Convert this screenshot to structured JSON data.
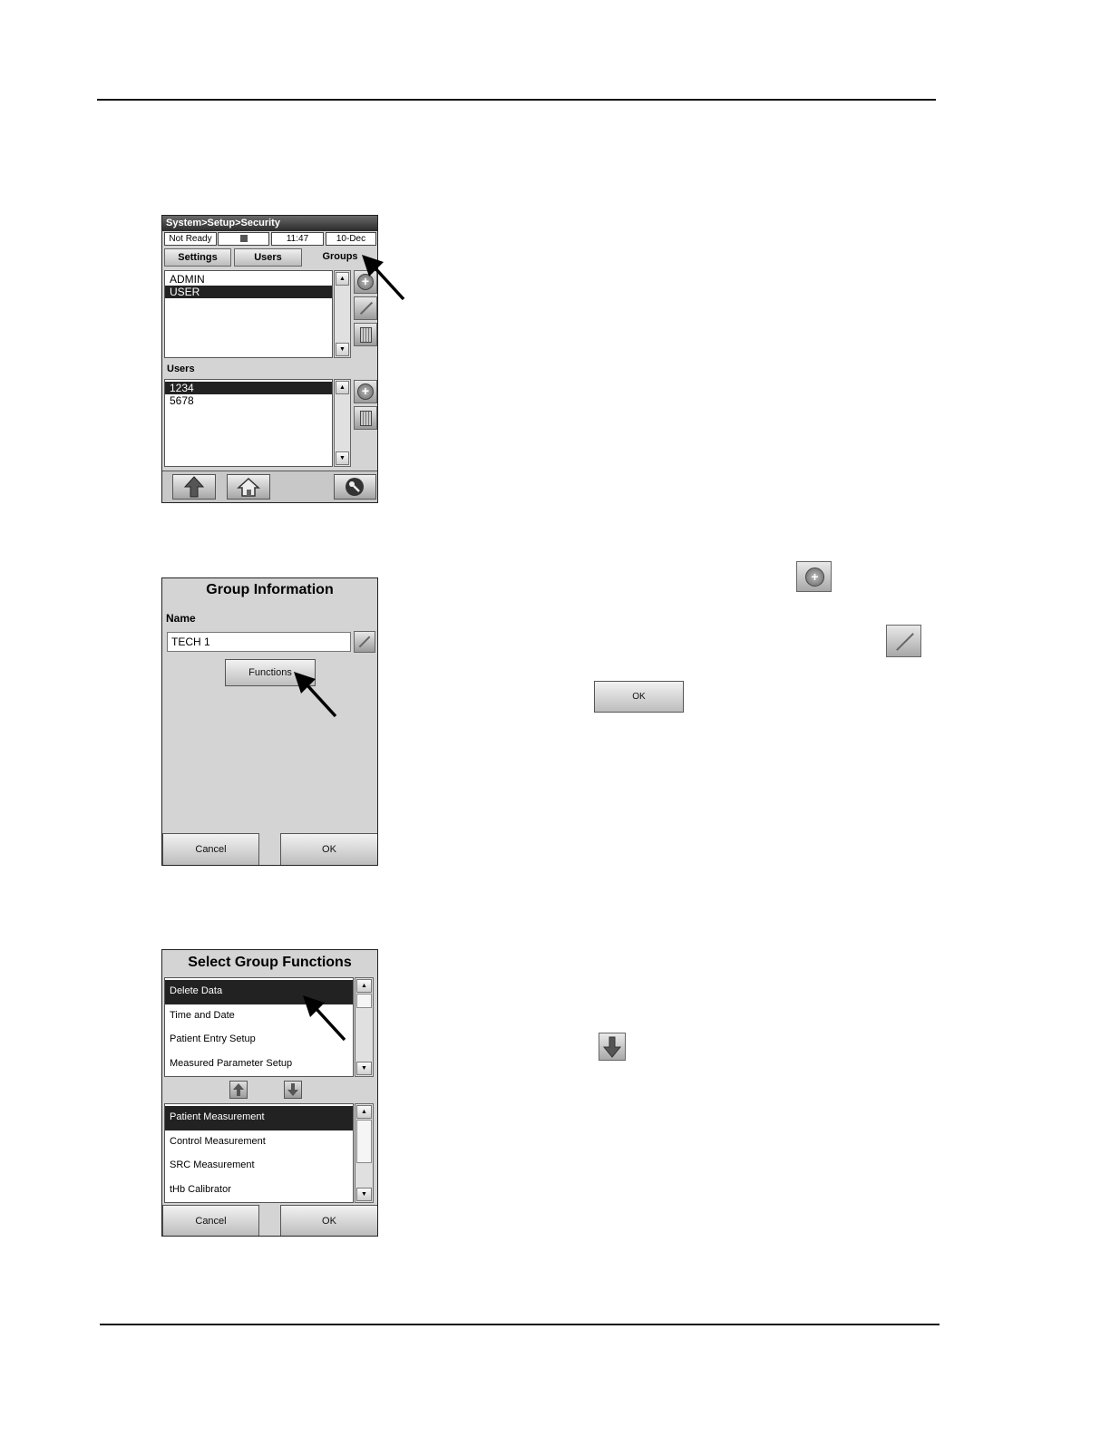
{
  "screen1": {
    "title": "System>Setup>Security",
    "status": {
      "state": "Not Ready",
      "time": "11:47",
      "date": "10-Dec"
    },
    "tabs": [
      "Settings",
      "Users",
      "Groups"
    ],
    "groups": [
      "ADMIN",
      "USER"
    ],
    "users_label": "Users",
    "users": [
      "1234",
      "5678"
    ],
    "icons": [
      "add-icon",
      "edit-icon",
      "delete-icon",
      "up-arrow-icon",
      "home-icon",
      "key-icon"
    ]
  },
  "screen2": {
    "title": "Group Information",
    "name_label": "Name",
    "name_value": "TECH 1",
    "functions_label": "Functions",
    "cancel_label": "Cancel",
    "ok_label": "OK"
  },
  "screen3": {
    "title": "Select Group Functions",
    "available": [
      "Delete Data",
      "Time and Date",
      "Patient Entry Setup",
      "Measured Parameter Setup"
    ],
    "selected": [
      "Patient Measurement",
      "Control Measurement",
      "SRC Measurement",
      "tHb Calibrator"
    ],
    "cancel_label": "Cancel",
    "ok_label": "OK"
  },
  "samples": {
    "ok_label": "OK"
  }
}
